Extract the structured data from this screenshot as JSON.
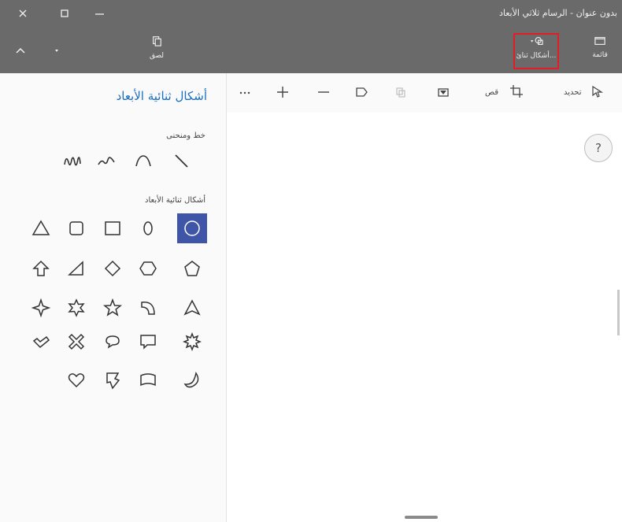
{
  "window": {
    "title": "بدون عنوان - الرسام ثلاثي الأبعاد",
    "controls": [
      "close-icon",
      "maximize-icon",
      "minimize-icon"
    ]
  },
  "ribbon": {
    "collapse_icon": "chevron-up-icon",
    "more_icon": "dropdown-caret-icon",
    "paste_label": "لصق",
    "shapes_label": "أشكال ثنائ...",
    "canvas_label": "قائمة",
    "highlight_color": "#e21d28"
  },
  "panel": {
    "title": "أشكال ثنائية الأبعاد",
    "lines_section": "خط ومنحنى",
    "lines": [
      "zigzag-line-icon",
      "s-curve-icon",
      "arc-curve-icon",
      "straight-line-icon"
    ],
    "shapes_section": "أشكال ثنائية الأبعاد",
    "shapes": [
      [
        "triangle-icon",
        "rounded-square-icon",
        "square-icon",
        "oval-outline-icon",
        "circle-icon"
      ],
      [
        "arrow-up-icon",
        "right-triangle-icon",
        "diamond-icon",
        "hexagon-icon",
        "pentagon-icon"
      ],
      [
        "four-point-star-icon",
        "six-point-star-icon",
        "five-point-star-icon",
        "crescent-shape-icon",
        "pyramid-icon"
      ],
      [
        "checkmark-shape-icon",
        "cross-x-icon",
        "thought-bubble-icon",
        "speech-bubble-icon",
        "burst-star-icon"
      ],
      [
        "heart-icon",
        "arrow-down-shape-icon",
        "scroll-banner-icon",
        "moon-icon"
      ]
    ],
    "selected_shape": "circle-icon",
    "selected_color": "#3f55a8",
    "accent_color": "#1a6fc2"
  },
  "toolbar": {
    "select_label": "تحديد",
    "crop_label": "قص",
    "tools": [
      "more-options-icon",
      "zoom-in-icon",
      "zoom-out-icon",
      "flag-icon",
      "copy-icon",
      "magic-select-icon",
      "crop-icon",
      "select-icon"
    ]
  },
  "canvas": {
    "help": "?"
  }
}
